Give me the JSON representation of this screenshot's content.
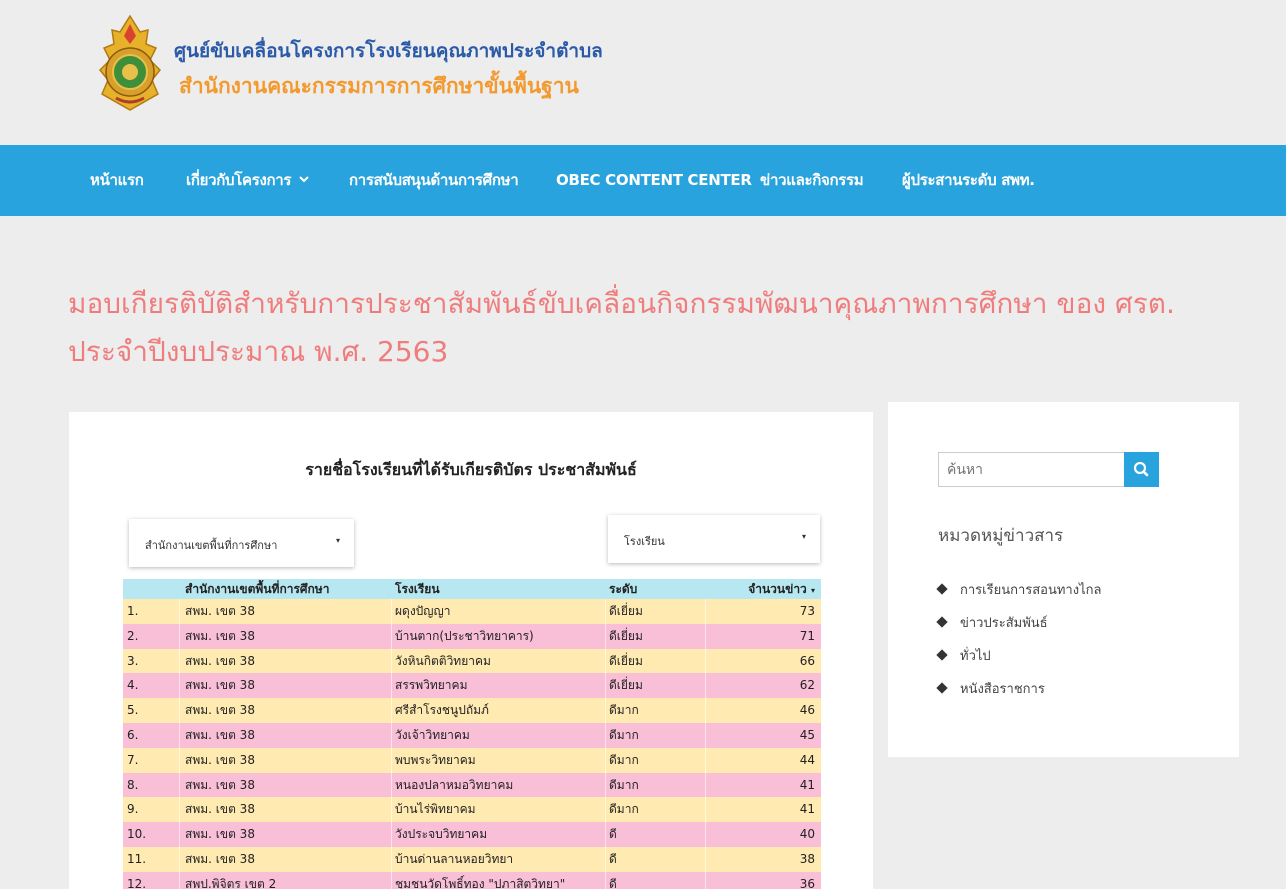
{
  "site": {
    "title_line1": "ศูนย์ขับเคลื่อนโครงการโรงเรียนคุณภาพประจำตำบล",
    "title_line2": "สำนักงานคณะกรรมการการศึกษาขั้นพื้นฐาน"
  },
  "nav": {
    "items": [
      {
        "label": "หน้าแรก"
      },
      {
        "label": "เกี่ยวกับโครงการ",
        "has_dropdown": true
      },
      {
        "label": "การสนับสนุนด้านการศึกษา"
      },
      {
        "label": "OBEC CONTENT CENTER"
      },
      {
        "label": "ข่าวและกิจกรรม"
      },
      {
        "label": "ผู้ประสานระดับ สพท."
      }
    ]
  },
  "post": {
    "title": "มอบเกียรติบัติสำหรับการประชาสัมพันธ์ขับเคลื่อนกิจกรรมพัฒนาคุณภาพการศึกษา ของ ศรต. ประจำปีงบประมาณ พ.ศ. 2563"
  },
  "report": {
    "title": "รายชื่อโรงเรียนที่ได้รับเกียรติบัตร ประชาสัมพันธ์",
    "filter_area": "สำนักงานเขตพื้นที่การศึกษา",
    "filter_school": "โรงเรียน",
    "columns": {
      "no": "",
      "area": "สำนักงานเขตพื้นที่การศึกษา",
      "school": "โรงเรียน",
      "level": "ระดับ",
      "count": "จำนวนข่าว"
    },
    "rows": [
      {
        "no": "1.",
        "area": "สพม. เขต 38",
        "school": "ผดุงปัญญา",
        "level": "ดีเยี่ยม",
        "count": "73"
      },
      {
        "no": "2.",
        "area": "สพม. เขต 38",
        "school": "บ้านตาก(ประชาวิทยาคาร)",
        "level": "ดีเยี่ยม",
        "count": "71"
      },
      {
        "no": "3.",
        "area": "สพม. เขต 38",
        "school": "วังหินกิตติวิทยาคม",
        "level": "ดีเยี่ยม",
        "count": "66"
      },
      {
        "no": "4.",
        "area": "สพม. เขต 38",
        "school": "สรรพวิทยาคม",
        "level": "ดีเยี่ยม",
        "count": "62"
      },
      {
        "no": "5.",
        "area": "สพม. เขต 38",
        "school": "ศรีสำโรงชนูปถัมภ์",
        "level": "ดีมาก",
        "count": "46"
      },
      {
        "no": "6.",
        "area": "สพม. เขต 38",
        "school": "วังเจ้าวิทยาคม",
        "level": "ดีมาก",
        "count": "45"
      },
      {
        "no": "7.",
        "area": "สพม. เขต 38",
        "school": "พบพระวิทยาคม",
        "level": "ดีมาก",
        "count": "44"
      },
      {
        "no": "8.",
        "area": "สพม. เขต 38",
        "school": "หนองปลาหมอวิทยาคม",
        "level": "ดีมาก",
        "count": "41"
      },
      {
        "no": "9.",
        "area": "สพม. เขต 38",
        "school": "บ้านไร่พิทยาคม",
        "level": "ดีมาก",
        "count": "41"
      },
      {
        "no": "10.",
        "area": "สพม. เขต 38",
        "school": "วังประจบวิทยาคม",
        "level": "ดี",
        "count": "40"
      },
      {
        "no": "11.",
        "area": "สพม. เขต 38",
        "school": "บ้านด่านลานหอยวิทยา",
        "level": "ดี",
        "count": "38"
      },
      {
        "no": "12.",
        "area": "สพป.พิจิตร เขต 2",
        "school": "ชุมชนวัดโพธิ์ทอง \"ปภาสิตวิทยา\"",
        "level": "ดี",
        "count": "36"
      }
    ]
  },
  "sidebar": {
    "search_placeholder": "ค้นหา",
    "categories_title": "หมวดหมู่ข่าวสาร",
    "categories": [
      {
        "label": "การเรียนการสอนทางไกล"
      },
      {
        "label": "ข่าวประสัมพันธ์"
      },
      {
        "label": "ทั่วไป"
      },
      {
        "label": "หนังสือราชการ"
      }
    ]
  },
  "colors": {
    "nav_bg": "#29a3dd",
    "title_pink": "#ef7d7d",
    "row_yellow": "#ffeab1",
    "row_pink": "#f9bfd6",
    "table_header": "#b7e7f1",
    "brand_blue": "#2a5aa8",
    "brand_orange": "#f29a2e"
  }
}
